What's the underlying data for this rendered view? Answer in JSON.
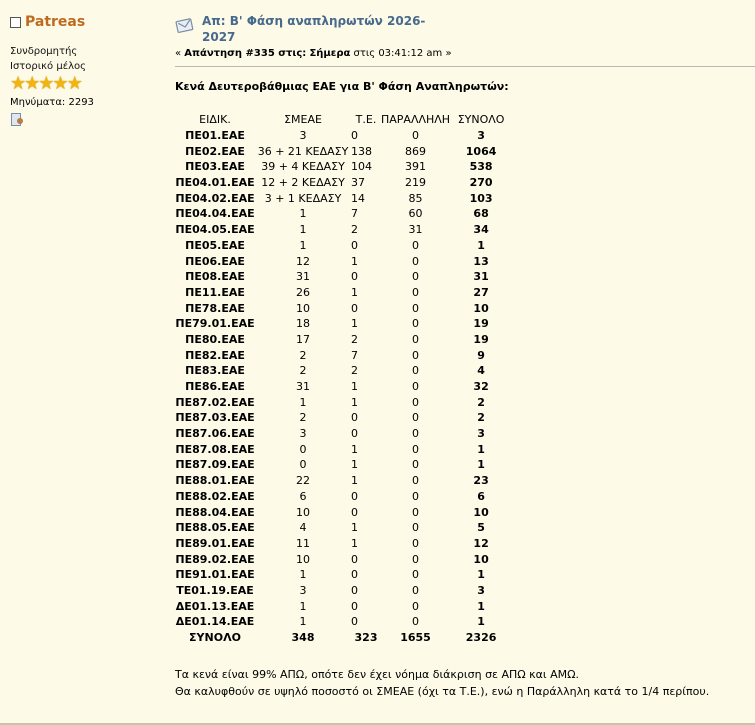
{
  "user": {
    "name": "Patreas",
    "role_lines": [
      "Συνδρομητής",
      "Ιστορικό μέλος"
    ],
    "stars": 5,
    "posts_label": "Μηνύματα:",
    "posts_count": "2293"
  },
  "post": {
    "title": "Απ: Β' Φάση αναπληρωτών 2026-2027",
    "reply_label": "Απάντηση #335 στις:",
    "date_bold": "Σήμερα",
    "time_text": "στις 03:41:12 am",
    "heading": "Κενά Δευτεροβάθμιας ΕΑΕ για Β' Φάση Αναπληρωτών:",
    "table": {
      "headers": [
        "ΕΙΔΙΚ.",
        "ΣΜΕΑΕ",
        "Τ.Ε.",
        "ΠΑΡΑΛΛΗΛΗ",
        "ΣΥΝΟΛΟ"
      ],
      "rows": [
        [
          "ΠΕ01.ΕΑΕ",
          "3",
          "0",
          "0",
          "3"
        ],
        [
          "ΠΕ02.ΕΑΕ",
          "36 + 21 ΚΕΔΑΣΥ",
          "138",
          "869",
          "1064"
        ],
        [
          "ΠΕ03.ΕΑΕ",
          "39 + 4 ΚΕΔΑΣΥ",
          "104",
          "391",
          "538"
        ],
        [
          "ΠΕ04.01.ΕΑΕ",
          "12 + 2 ΚΕΔΑΣΥ",
          "37",
          "219",
          "270"
        ],
        [
          "ΠΕ04.02.ΕΑΕ",
          "3 + 1 ΚΕΔΑΣΥ",
          "14",
          "85",
          "103"
        ],
        [
          "ΠΕ04.04.ΕΑΕ",
          "1",
          "7",
          "60",
          "68"
        ],
        [
          "ΠΕ04.05.ΕΑΕ",
          "1",
          "2",
          "31",
          "34"
        ],
        [
          "ΠΕ05.ΕΑΕ",
          "1",
          "0",
          "0",
          "1"
        ],
        [
          "ΠΕ06.ΕΑΕ",
          "12",
          "1",
          "0",
          "13"
        ],
        [
          "ΠΕ08.ΕΑΕ",
          "31",
          "0",
          "0",
          "31"
        ],
        [
          "ΠΕ11.ΕΑΕ",
          "26",
          "1",
          "0",
          "27"
        ],
        [
          "ΠΕ78.ΕΑΕ",
          "10",
          "0",
          "0",
          "10"
        ],
        [
          "ΠΕ79.01.ΕΑΕ",
          "18",
          "1",
          "0",
          "19"
        ],
        [
          "ΠΕ80.ΕΑΕ",
          "17",
          "2",
          "0",
          "19"
        ],
        [
          "ΠΕ82.ΕΑΕ",
          "2",
          "7",
          "0",
          "9"
        ],
        [
          "ΠΕ83.ΕΑΕ",
          "2",
          "2",
          "0",
          "4"
        ],
        [
          "ΠΕ86.ΕΑΕ",
          "31",
          "1",
          "0",
          "32"
        ],
        [
          "ΠΕ87.02.ΕΑΕ",
          "1",
          "1",
          "0",
          "2"
        ],
        [
          "ΠΕ87.03.ΕΑΕ",
          "2",
          "0",
          "0",
          "2"
        ],
        [
          "ΠΕ87.06.ΕΑΕ",
          "3",
          "0",
          "0",
          "3"
        ],
        [
          "ΠΕ87.08.ΕΑΕ",
          "0",
          "1",
          "0",
          "1"
        ],
        [
          "ΠΕ87.09.ΕΑΕ",
          "0",
          "1",
          "0",
          "1"
        ],
        [
          "ΠΕ88.01.ΕΑΕ",
          "22",
          "1",
          "0",
          "23"
        ],
        [
          "ΠΕ88.02.ΕΑΕ",
          "6",
          "0",
          "0",
          "6"
        ],
        [
          "ΠΕ88.04.ΕΑΕ",
          "10",
          "0",
          "0",
          "10"
        ],
        [
          "ΠΕ88.05.ΕΑΕ",
          "4",
          "1",
          "0",
          "5"
        ],
        [
          "ΠΕ89.01.ΕΑΕ",
          "11",
          "1",
          "0",
          "12"
        ],
        [
          "ΠΕ89.02.ΕΑΕ",
          "10",
          "0",
          "0",
          "10"
        ],
        [
          "ΠΕ91.01.ΕΑΕ",
          "1",
          "0",
          "0",
          "1"
        ],
        [
          "ΤΕ01.19.ΕΑΕ",
          "3",
          "0",
          "0",
          "3"
        ],
        [
          "ΔΕ01.13.ΕΑΕ",
          "1",
          "0",
          "0",
          "1"
        ],
        [
          "ΔΕ01.14.ΕΑΕ",
          "1",
          "0",
          "0",
          "1"
        ]
      ],
      "total": [
        "ΣΥΝΟΛΟ",
        "348",
        "323",
        "1655",
        "2326"
      ]
    },
    "notes": [
      "Τα κενά είναι 99% ΑΠΩ, οπότε δεν έχει νόημα διάκριση σε ΑΠΩ και ΑΜΩ.",
      "Θα καλυφθούν σε υψηλό ποσοστό οι ΣΜΕΑΕ (όχι τα Τ.Ε.), ενώ η Παράλληλη κατά το 1/4 περίπου."
    ]
  }
}
